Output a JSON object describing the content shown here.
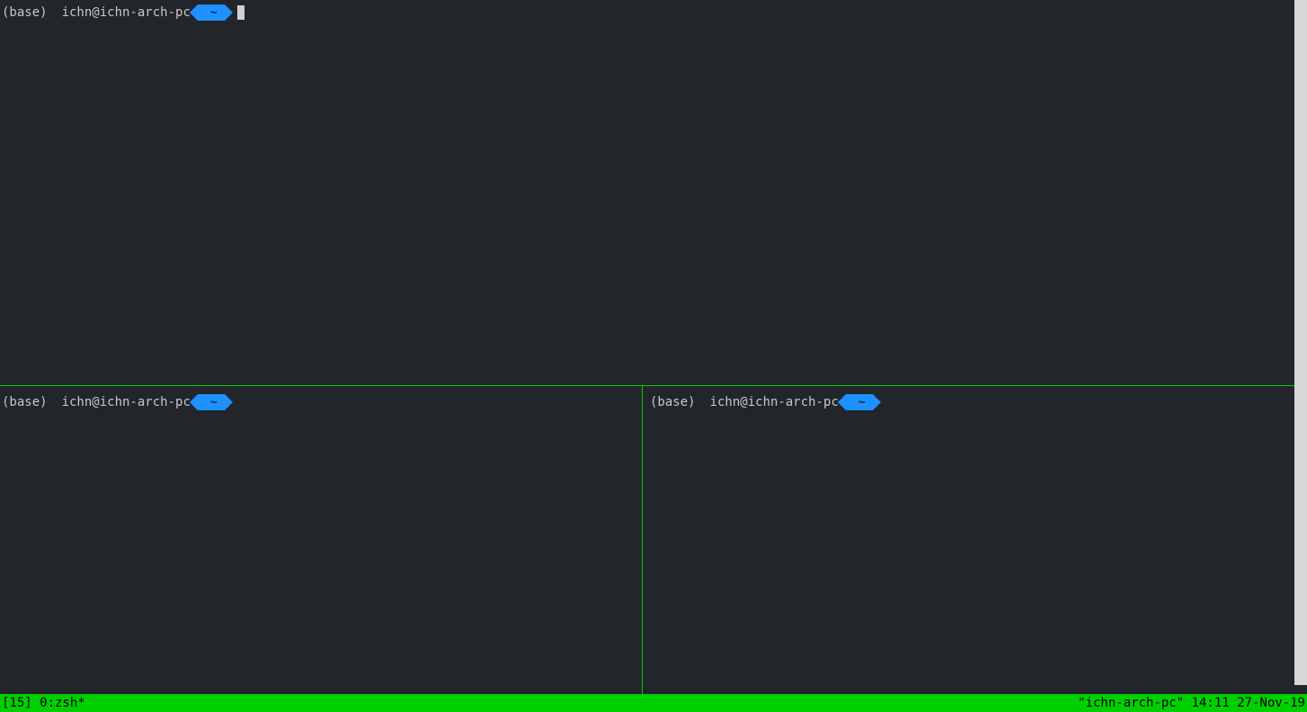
{
  "panes": {
    "top": {
      "env": "(base)",
      "user": "ichn@ichn-arch-pc",
      "cwd": "~",
      "has_cursor": true
    },
    "bottom_left": {
      "env": "(base)",
      "user": "ichn@ichn-arch-pc",
      "cwd": "~",
      "has_cursor": false
    },
    "bottom_right": {
      "env": "(base)",
      "user": "ichn@ichn-arch-pc",
      "cwd": "~",
      "has_cursor": false
    }
  },
  "status": {
    "left": "[15] 0:zsh*",
    "right": "\"ichn-arch-pc\" 14:11 27-Nov-19"
  }
}
